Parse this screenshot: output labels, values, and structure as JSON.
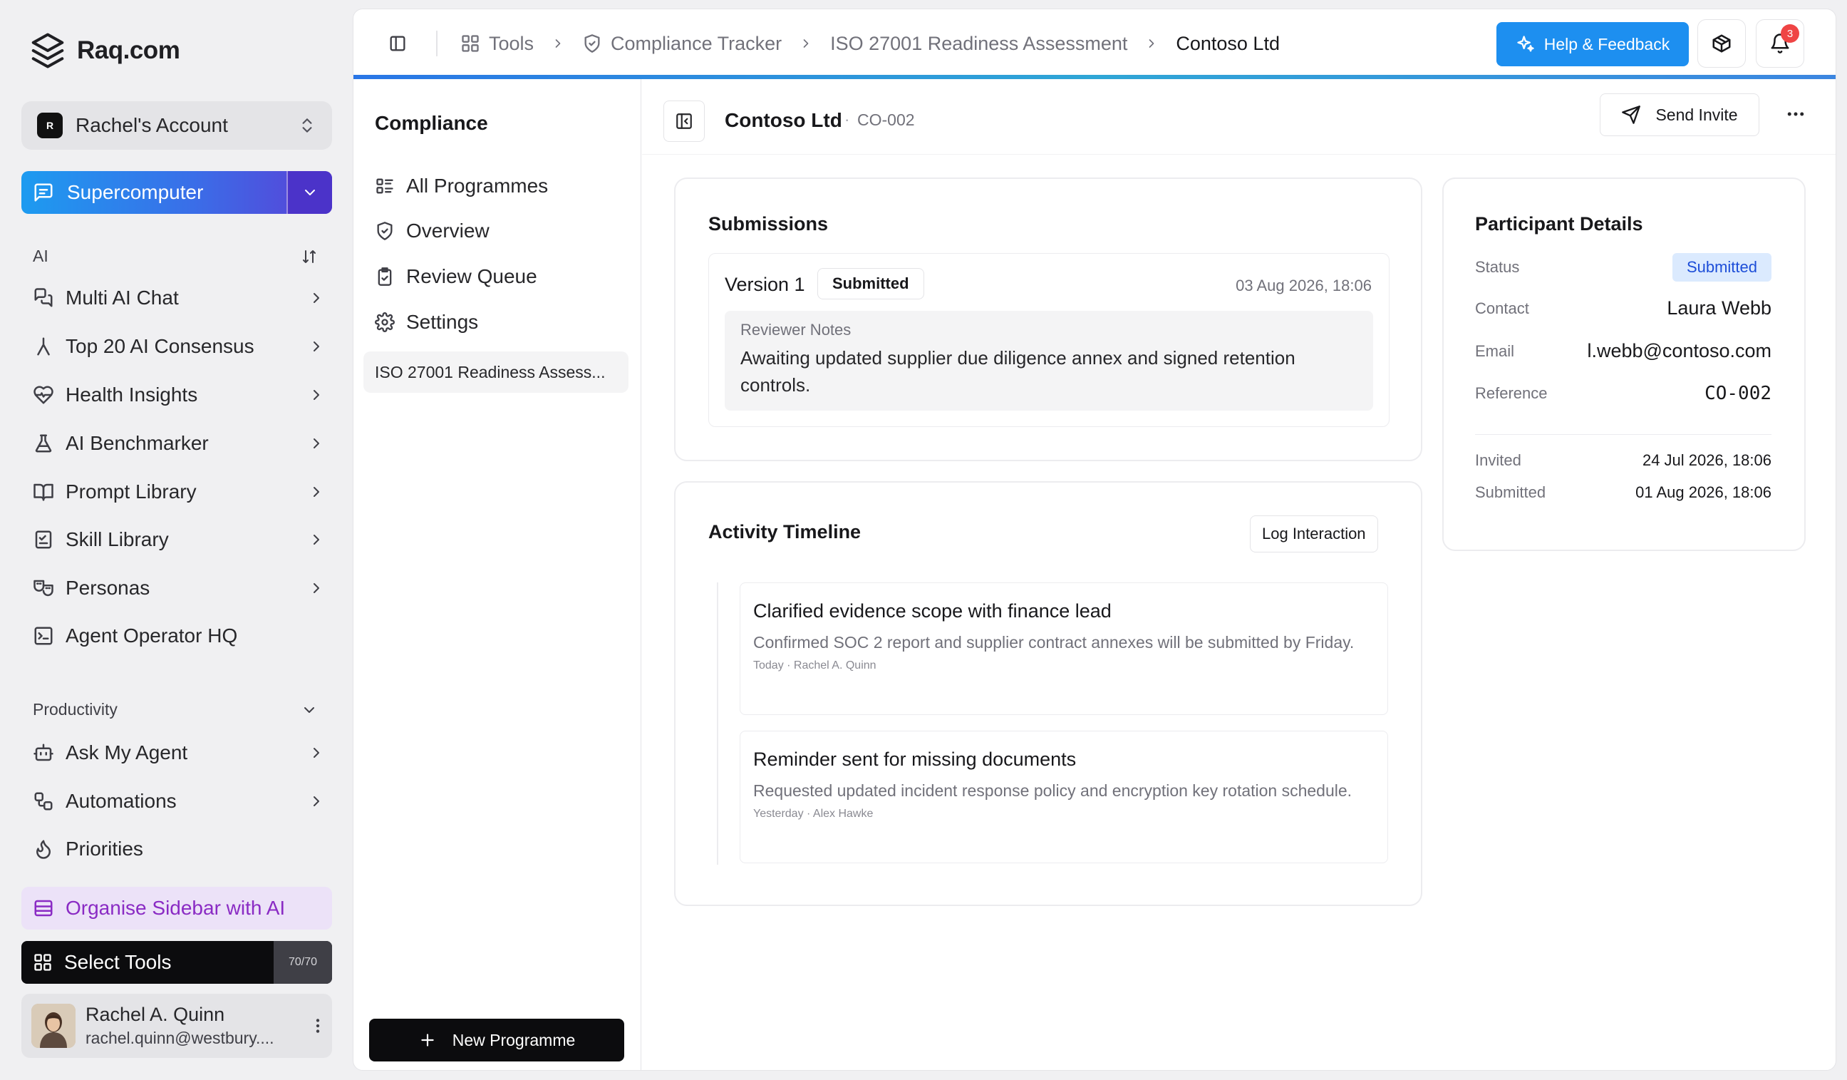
{
  "brand": {
    "name": "Raq.com"
  },
  "account": {
    "badge": "R",
    "name": "Rachel's Account"
  },
  "supercomputer": {
    "label": "Supercomputer"
  },
  "sidebar": {
    "ai_section": "AI",
    "ai_items": [
      {
        "label": "Multi AI Chat",
        "icon": "chat-bubbles-icon"
      },
      {
        "label": "Top 20 AI Consensus",
        "icon": "fork-icon"
      },
      {
        "label": "Health Insights",
        "icon": "heart-pulse-icon"
      },
      {
        "label": "AI Benchmarker",
        "icon": "flask-icon"
      },
      {
        "label": "Prompt Library",
        "icon": "book-icon"
      },
      {
        "label": "Skill Library",
        "icon": "checklist-icon"
      },
      {
        "label": "Personas",
        "icon": "masks-icon"
      },
      {
        "label": "Agent Operator HQ",
        "icon": "terminal-icon"
      }
    ],
    "productivity_section": "Productivity",
    "productivity_items": [
      {
        "label": "Ask My Agent",
        "icon": "robot-icon"
      },
      {
        "label": "Automations",
        "icon": "workflow-icon"
      },
      {
        "label": "Priorities",
        "icon": "flame-icon"
      }
    ],
    "organise": "Organise Sidebar with AI",
    "select_tools": "Select Tools",
    "tools_count": "70/70"
  },
  "user": {
    "name": "Rachel A. Quinn",
    "email": "rachel.quinn@westbury...."
  },
  "breadcrumbs": {
    "tools": "Tools",
    "tracker": "Compliance Tracker",
    "assessment": "ISO 27001 Readiness Assessment",
    "current": "Contoso Ltd"
  },
  "topbar": {
    "help": "Help & Feedback",
    "notifications": "3"
  },
  "subpanel": {
    "title": "Compliance",
    "items": [
      {
        "label": "All Programmes"
      },
      {
        "label": "Overview"
      },
      {
        "label": "Review Queue"
      },
      {
        "label": "Settings"
      }
    ],
    "selected": "ISO 27001 Readiness Assess...",
    "new_programme": "New Programme"
  },
  "header": {
    "title": "Contoso Ltd",
    "separator": "·",
    "code": "CO-002",
    "send_invite": "Send Invite"
  },
  "submissions": {
    "title": "Submissions",
    "version": "Version 1",
    "badge": "Submitted",
    "date": "03 Aug 2026, 18:06",
    "notes_label": "Reviewer Notes",
    "notes": "Awaiting updated supplier due diligence annex and signed retention controls."
  },
  "timeline": {
    "title": "Activity Timeline",
    "log_button": "Log Interaction",
    "entries": [
      {
        "title": "Clarified evidence scope with finance lead",
        "desc": "Confirmed SOC 2 report and supplier contract annexes will be submitted by Friday.",
        "meta": "Today · Rachel A. Quinn"
      },
      {
        "title": "Reminder sent for missing documents",
        "desc": "Requested updated incident response policy and encryption key rotation schedule.",
        "meta": "Yesterday · Alex Hawke"
      }
    ]
  },
  "participant": {
    "title": "Participant Details",
    "status_label": "Status",
    "status": "Submitted",
    "contact_label": "Contact",
    "contact": "Laura Webb",
    "email_label": "Email",
    "email": "l.webb@contoso.com",
    "reference_label": "Reference",
    "reference": "CO-002",
    "invited_label": "Invited",
    "invited": "24 Jul 2026, 18:06",
    "submitted_label": "Submitted",
    "submitted": "01 Aug 2026, 18:06"
  },
  "colors": {
    "accent": "#1d8ff0",
    "organise": "#8a2bc4",
    "status_bg": "#dbeafe",
    "status_text": "#1d4ed8",
    "badge": "#ef4444"
  }
}
